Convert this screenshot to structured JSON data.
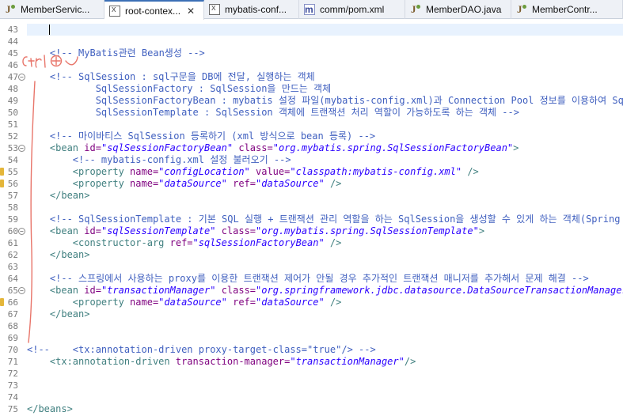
{
  "tabs": [
    {
      "label": "MemberServic...",
      "icon": "java-file-icon",
      "type": "java",
      "active": false,
      "closable": false
    },
    {
      "label": "root-contex...",
      "icon": "xml-file-icon",
      "type": "xml",
      "active": true,
      "closable": true,
      "close": "✕"
    },
    {
      "label": "mybatis-conf...",
      "icon": "xml-file-icon",
      "type": "xml",
      "active": false,
      "closable": false
    },
    {
      "label": "comm/pom.xml",
      "icon": "maven-pom-icon",
      "type": "pom",
      "active": false,
      "closable": false
    },
    {
      "label": "MemberDAO.java",
      "icon": "java-file-icon",
      "type": "java",
      "active": false,
      "closable": false
    },
    {
      "label": "MemberContr...",
      "icon": "java-file-icon",
      "type": "java",
      "active": false,
      "closable": false
    }
  ],
  "annotation": {
    "text": "ctrl+/",
    "color": "#e8756a"
  },
  "warning_color": "#e4b63a",
  "editor": {
    "lines": [
      {
        "n": "43",
        "cur": true,
        "segs": []
      },
      {
        "n": "44",
        "segs": []
      },
      {
        "n": "45",
        "segs": [
          {
            "t": "    "
          },
          {
            "t": "<!-- MyBatis관련 Bean생성 -->",
            "c": "c"
          }
        ]
      },
      {
        "n": "46",
        "segs": []
      },
      {
        "n": "47",
        "fold": true,
        "segs": [
          {
            "t": "    "
          },
          {
            "t": "<!-- SqlSession : sql구문을 DB에 전달, 실행하는 객체",
            "c": "c"
          }
        ]
      },
      {
        "n": "48",
        "segs": [
          {
            "t": "            SqlSessionFactory : SqlSession을 만드는 객체",
            "c": "c"
          }
        ]
      },
      {
        "n": "49",
        "segs": [
          {
            "t": "            SqlSessionFactoryBean : mybatis 설정 파일(mybatis-config.xml)과 Connection Pool 정보를 이용하여 SqlSessionFactory를 만드는 객체",
            "c": "c"
          }
        ]
      },
      {
        "n": "50",
        "segs": [
          {
            "t": "            SqlSessionTemplate : SqlSession 객체에 트랜잭션 처리 역할이 가능하도록 하는 객체 -->",
            "c": "c"
          }
        ]
      },
      {
        "n": "51",
        "segs": []
      },
      {
        "n": "52",
        "segs": [
          {
            "t": "    "
          },
          {
            "t": "<!-- 마이바티스 SqlSession 등록하기 (xml 방식으로 bean 등록) -->",
            "c": "c"
          }
        ]
      },
      {
        "n": "53",
        "fold": true,
        "segs": [
          {
            "t": "    "
          },
          {
            "t": "<bean ",
            "c": "tag"
          },
          {
            "t": "id=",
            "c": "attr"
          },
          {
            "t": "\"sqlSessionFactoryBean\"",
            "c": "val"
          },
          {
            "t": " "
          },
          {
            "t": "class=",
            "c": "attr"
          },
          {
            "t": "\"org.mybatis.spring.SqlSessionFactoryBean\"",
            "c": "val"
          },
          {
            "t": ">",
            "c": "tag"
          }
        ]
      },
      {
        "n": "54",
        "segs": [
          {
            "t": "        "
          },
          {
            "t": "<!-- mybatis-config.xml 설정 불러오기 -->",
            "c": "c"
          }
        ]
      },
      {
        "n": "55",
        "warn": true,
        "segs": [
          {
            "t": "        "
          },
          {
            "t": "<property ",
            "c": "tag"
          },
          {
            "t": "name=",
            "c": "attr"
          },
          {
            "t": "\"configLocation\"",
            "c": "val"
          },
          {
            "t": " "
          },
          {
            "t": "value=",
            "c": "attr"
          },
          {
            "t": "\"classpath:mybatis-config.xml\"",
            "c": "val"
          },
          {
            "t": " />",
            "c": "tag"
          }
        ]
      },
      {
        "n": "56",
        "warn": true,
        "segs": [
          {
            "t": "        "
          },
          {
            "t": "<property ",
            "c": "tag"
          },
          {
            "t": "name=",
            "c": "attr"
          },
          {
            "t": "\"dataSource\"",
            "c": "val"
          },
          {
            "t": " "
          },
          {
            "t": "ref=",
            "c": "attr"
          },
          {
            "t": "\"dataSource\"",
            "c": "val"
          },
          {
            "t": " />",
            "c": "tag"
          }
        ]
      },
      {
        "n": "57",
        "segs": [
          {
            "t": "    "
          },
          {
            "t": "</bean>",
            "c": "tag"
          }
        ]
      },
      {
        "n": "58",
        "segs": []
      },
      {
        "n": "59",
        "segs": [
          {
            "t": "    "
          },
          {
            "t": "<!-- SqlSessionTemplate : 기본 SQL 실행 + 트랜잭션 관리 역할을 하는 SqlSession을 생성할 수 있게 하는 객체(Spring bean으로 등록해야함) -->",
            "c": "c"
          }
        ]
      },
      {
        "n": "60",
        "fold": true,
        "segs": [
          {
            "t": "    "
          },
          {
            "t": "<bean ",
            "c": "tag"
          },
          {
            "t": "id=",
            "c": "attr"
          },
          {
            "t": "\"sqlSessionTemplate\"",
            "c": "val"
          },
          {
            "t": " "
          },
          {
            "t": "class=",
            "c": "attr"
          },
          {
            "t": "\"org.mybatis.spring.SqlSessionTemplate\"",
            "c": "val"
          },
          {
            "t": ">",
            "c": "tag"
          }
        ]
      },
      {
        "n": "61",
        "segs": [
          {
            "t": "        "
          },
          {
            "t": "<constructor-arg ",
            "c": "tag"
          },
          {
            "t": "ref=",
            "c": "attr"
          },
          {
            "t": "\"sqlSessionFactoryBean\"",
            "c": "val"
          },
          {
            "t": " />",
            "c": "tag"
          }
        ]
      },
      {
        "n": "62",
        "segs": [
          {
            "t": "    "
          },
          {
            "t": "</bean>",
            "c": "tag"
          }
        ]
      },
      {
        "n": "63",
        "segs": []
      },
      {
        "n": "64",
        "segs": [
          {
            "t": "    "
          },
          {
            "t": "<!-- 스프링에서 사용하는 proxy를 이용한 트랜잭션 제어가 안될 경우 추가적인 트랜잭션 매니저를 추가해서 문제 해결 -->",
            "c": "c"
          }
        ]
      },
      {
        "n": "65",
        "fold": true,
        "segs": [
          {
            "t": "    "
          },
          {
            "t": "<bean ",
            "c": "tag"
          },
          {
            "t": "id=",
            "c": "attr"
          },
          {
            "t": "\"transactionManager\"",
            "c": "val"
          },
          {
            "t": " "
          },
          {
            "t": "class=",
            "c": "attr"
          },
          {
            "t": "\"org.springframework.jdbc.datasource.DataSourceTransactionManager\"",
            "c": "val"
          },
          {
            "t": ">",
            "c": "tag"
          }
        ]
      },
      {
        "n": "66",
        "warn": true,
        "segs": [
          {
            "t": "        "
          },
          {
            "t": "<property ",
            "c": "tag"
          },
          {
            "t": "name=",
            "c": "attr"
          },
          {
            "t": "\"dataSource\"",
            "c": "val"
          },
          {
            "t": " "
          },
          {
            "t": "ref=",
            "c": "attr"
          },
          {
            "t": "\"dataSource\"",
            "c": "val"
          },
          {
            "t": " />",
            "c": "tag"
          }
        ]
      },
      {
        "n": "67",
        "segs": [
          {
            "t": "    "
          },
          {
            "t": "</bean>",
            "c": "tag"
          }
        ]
      },
      {
        "n": "68",
        "segs": []
      },
      {
        "n": "69",
        "segs": []
      },
      {
        "n": "70",
        "segs": [
          {
            "t": "<!--    <tx:annotation-driven proxy-target-class=\"true\"/> -->",
            "c": "c"
          }
        ]
      },
      {
        "n": "71",
        "segs": [
          {
            "t": "    "
          },
          {
            "t": "<tx:annotation-driven ",
            "c": "tag"
          },
          {
            "t": "transaction-manager=",
            "c": "attr"
          },
          {
            "t": "\"transactionManager\"",
            "c": "val"
          },
          {
            "t": "/>",
            "c": "tag"
          }
        ]
      },
      {
        "n": "72",
        "segs": []
      },
      {
        "n": "73",
        "segs": []
      },
      {
        "n": "74",
        "segs": []
      },
      {
        "n": "75",
        "segs": [
          {
            "t": "</beans>",
            "c": "tag"
          }
        ]
      }
    ]
  }
}
